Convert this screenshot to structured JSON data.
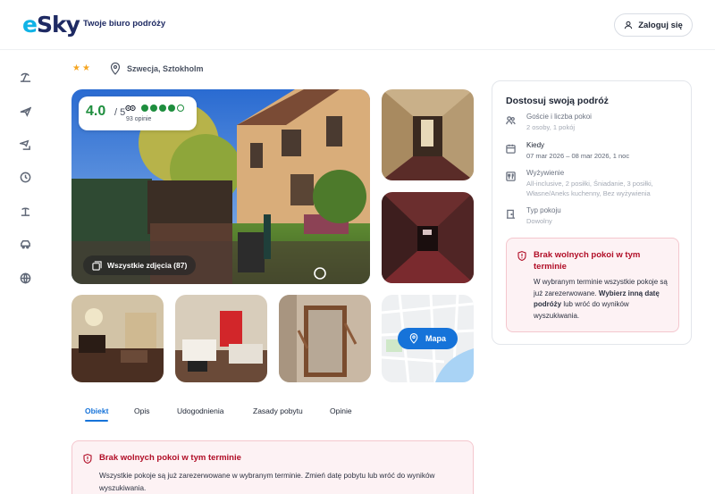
{
  "header": {
    "logo": "eSky",
    "tagline": "Twoje biuro podróży",
    "login_label": "Zaloguj się"
  },
  "rail": {
    "icons": [
      "beach-icon",
      "plane-icon",
      "plane-hotel-icon",
      "clock-icon",
      "island-icon",
      "car-icon",
      "globe-icon"
    ]
  },
  "hotel": {
    "stars": "★★",
    "location": "Szwecja, Sztokholm"
  },
  "rating": {
    "score": "4.0",
    "max": "/ 5",
    "reviews": "93 opinie",
    "filled_dots": 4,
    "total_dots": 5
  },
  "gallery": {
    "all_photos_label": "Wszystkie zdjęcia (87)",
    "map_label": "Mapa"
  },
  "tabs": [
    "Obiekt",
    "Opis",
    "Udogodnienia",
    "Zasady pobytu",
    "Opinie"
  ],
  "active_tab": "Obiekt",
  "alert_bottom": {
    "title": "Brak wolnych pokoi w tym terminie",
    "body": "Wszystkie pokoje są już zarezerwowane w wybranym terminie. Zmień datę pobytu lub wróć do wyników wyszukiwania."
  },
  "panel": {
    "title": "Dostosuj swoją podróż",
    "guests_label": "Goście i liczba pokoi",
    "guests_value": "2 osoby, 1 pokój",
    "when_label": "Kiedy",
    "when_value": "07 mar 2026 – 08 mar 2026, 1 noc",
    "board_label": "Wyżywienie",
    "board_value": "All-inclusive, 2 posiłki, Śniadanie, 3 posiłki, Własne/Aneks kuchenny, Bez wyżywienia",
    "room_label": "Typ pokoju",
    "room_value": "Dowolny",
    "alert_title": "Brak wolnych pokoi w tym terminie",
    "alert_body_1": "W wybranym terminie wszystkie pokoje są już zarezerwowane. ",
    "alert_body_bold": "Wybierz inną datę podróży",
    "alert_body_2": " lub wróć do wyników wyszukiwania."
  },
  "colors": {
    "brand_blue": "#1673d9",
    "logo_navy": "#1e2a63",
    "logo_cyan": "#10b3e6",
    "rating_green": "#1e8e3e",
    "alert_red": "#b10e27",
    "alert_bg": "#fdf2f4"
  }
}
